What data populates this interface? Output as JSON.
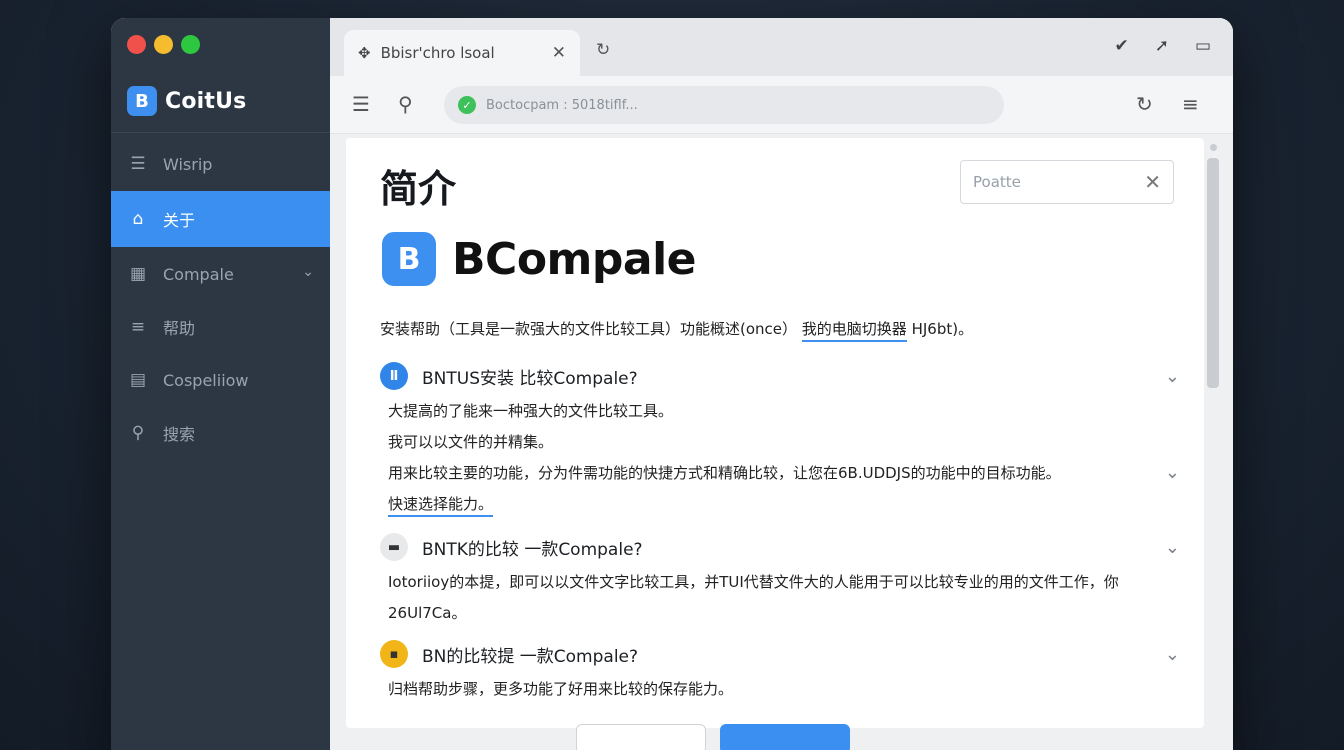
{
  "app": {
    "brand_logo": "B",
    "brand_name": "CoitUs"
  },
  "sidebar": {
    "items": [
      {
        "label": "Wisrip",
        "icon": "list-icon"
      },
      {
        "label": "关于",
        "icon": "home-icon",
        "active": true
      },
      {
        "label": "Compale",
        "icon": "calendar-icon",
        "has_chevron": true
      },
      {
        "label": "帮助",
        "icon": "menu-icon"
      },
      {
        "label": "Cospeliiow",
        "icon": "document-icon"
      },
      {
        "label": "搜索",
        "icon": "search-icon"
      }
    ]
  },
  "browser": {
    "tab_title": "Bbisr'chro lsoal",
    "url": "Boctocpam : 5018tiflf..."
  },
  "content": {
    "page_title": "简介",
    "search_placeholder": "Poatte",
    "logo_letter": "B",
    "logo_text": "BCompale",
    "intro_before": "安装帮助（工具是一款强大的文件比较工具）功能概述(once）",
    "intro_link": "我的电脑切换器",
    "intro_after": "HJ6bt)。",
    "faq": [
      {
        "title": "BNTUS安装 比较Compale?",
        "icon_color": "#2f86e8",
        "lines": [
          {
            "text": "大提高的了能来一种强大的文件比较工具。"
          },
          {
            "text": "我可以以文件的并精集。"
          },
          {
            "text": "用来比较主要的功能，分为件需功能的快捷方式和精确比较，让您在6B.UDDJS的功能中的目标功能。",
            "has_chevron": true
          },
          {
            "text": "快速选择能力。",
            "link": true
          }
        ]
      },
      {
        "title": "BNTK的比较 一款Compale?",
        "icon_color": "#e8e9eb",
        "lines": [
          {
            "text": "Iotoriioy的本提，即可以以文件文字比较工具，并TUI代替文件大的人能用于可以比较专业的用的文件工作，你"
          },
          {
            "text": "26Ul7Ca。"
          }
        ]
      },
      {
        "title": "BN的比较提 一款Compale?",
        "icon_color": "#f2b517",
        "lines": [
          {
            "text": "归档帮助步骤，更多功能了好用来比较的保存能力。"
          }
        ]
      }
    ]
  },
  "colors": {
    "accent": "#3a8ff0",
    "sidebar_bg": "#2d3744"
  }
}
